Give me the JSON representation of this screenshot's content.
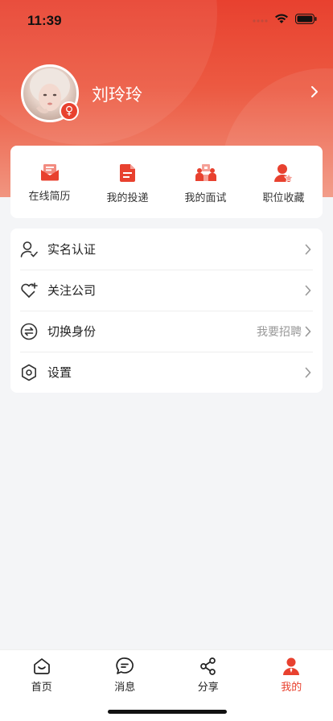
{
  "status_bar": {
    "time": "11:39"
  },
  "profile": {
    "name": "刘玲玲",
    "gender_symbol": "♀"
  },
  "quick_actions": [
    {
      "label": "在线简历",
      "icon": "resume-icon"
    },
    {
      "label": "我的投递",
      "icon": "document-icon"
    },
    {
      "label": "我的面试",
      "icon": "interview-icon"
    },
    {
      "label": "职位收藏",
      "icon": "favorite-user-icon"
    }
  ],
  "menu": [
    {
      "label": "实名认证",
      "value": "",
      "icon": "user-verify-icon"
    },
    {
      "label": "关注公司",
      "value": "",
      "icon": "heart-plus-icon"
    },
    {
      "label": "切换身份",
      "value": "我要招聘",
      "icon": "switch-icon"
    },
    {
      "label": "设置",
      "value": "",
      "icon": "settings-icon"
    }
  ],
  "tabs": [
    {
      "label": "首页",
      "icon": "home-icon",
      "active": false
    },
    {
      "label": "消息",
      "icon": "message-icon",
      "active": false
    },
    {
      "label": "分享",
      "icon": "share-icon",
      "active": false
    },
    {
      "label": "我的",
      "icon": "profile-icon",
      "active": true
    }
  ],
  "colors": {
    "accent": "#e8412f",
    "background": "#f4f5f7"
  }
}
